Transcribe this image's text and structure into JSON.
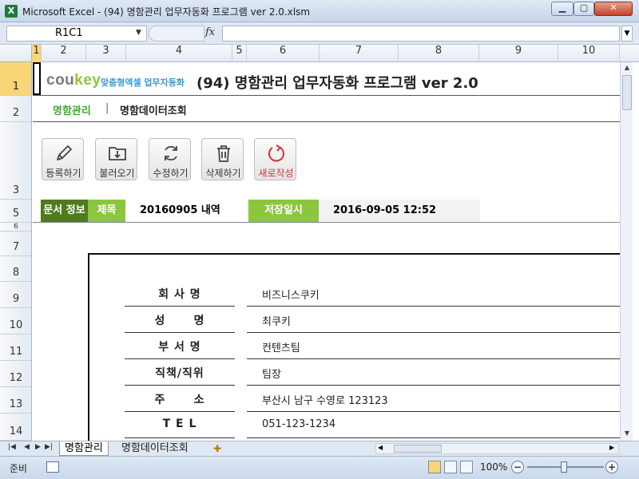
{
  "window": {
    "title": "Microsoft Excel - (94) 명함관리 업무자동화 프로그램 ver 2.0.xlsm",
    "app_icon_letter": "X",
    "min_glyph": "▁",
    "max_glyph": "▢",
    "close_glyph": "✕"
  },
  "formula_bar": {
    "name_box": "R1C1",
    "fx": "fx",
    "value": ""
  },
  "columns": [
    "1",
    "2",
    "3",
    "4",
    "5",
    "6",
    "7",
    "8",
    "9",
    "10"
  ],
  "rows": [
    "1",
    "2",
    "3",
    "5",
    "6",
    "7",
    "8",
    "9",
    "10",
    "11",
    "12",
    "13",
    "14"
  ],
  "header": {
    "logo_main": "cou",
    "logo_accent": "key",
    "logo_tagline": "맞춤형엑셀 업무자동화",
    "title": "(94) 명함관리 업무자동화 프로그램 ver 2.0"
  },
  "nav": {
    "tab1": "명함관리",
    "separator": "|",
    "tab2": "명함데이터조회"
  },
  "toolbar": {
    "register": "등록하기",
    "load": "불러오기",
    "edit": "수정하기",
    "delete": "삭제하기",
    "new": "새로작성"
  },
  "doc_info": {
    "label": "문서 정보",
    "title_label": "제목",
    "title_value": "20160905 내역",
    "saved_label": "저장일시",
    "saved_value": "2016-09-05 12:52"
  },
  "card": {
    "fields": [
      {
        "label": "회 사 명",
        "value": "비즈니스쿠키"
      },
      {
        "label": "성      명",
        "value": "최쿠키"
      },
      {
        "label": "부 서 명",
        "value": "컨텐츠팀"
      },
      {
        "label": "직책/직위",
        "value": "팀장"
      },
      {
        "label": "주      소",
        "value": "부산시 남구 수영로 123123"
      },
      {
        "label": "T E L",
        "value": "051-123-1234"
      }
    ]
  },
  "sheet_tabs": {
    "tab1": "명함관리",
    "tab2": "명함데이터조회"
  },
  "status": {
    "ready": "준비",
    "zoom": "100%"
  }
}
